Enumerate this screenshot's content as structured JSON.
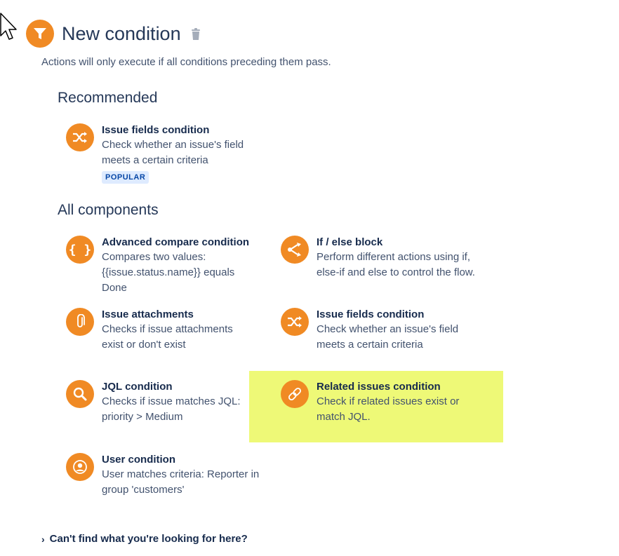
{
  "header": {
    "title": "New condition",
    "subtitle": "Actions will only execute if all conditions preceding them pass."
  },
  "recommended": {
    "heading": "Recommended",
    "items": [
      {
        "icon": "shuffle-icon",
        "title": "Issue fields condition",
        "desc": "Check whether an issue's field meets a certain criteria",
        "badge": "POPULAR"
      }
    ]
  },
  "all": {
    "heading": "All components",
    "items": [
      {
        "icon": "braces-icon",
        "title": "Advanced compare condition",
        "desc": "Compares two values: {{issue.status.name}} equals Done"
      },
      {
        "icon": "branch-icon",
        "title": "If / else block",
        "desc": "Perform different actions using if, else-if and else to control the flow."
      },
      {
        "icon": "paperclip-icon",
        "title": "Issue attachments",
        "desc": "Checks if issue attachments exist or don't exist"
      },
      {
        "icon": "shuffle-icon",
        "title": "Issue fields condition",
        "desc": "Check whether an issue's field meets a certain criteria"
      },
      {
        "icon": "search-icon",
        "title": "JQL condition",
        "desc": "Checks if issue matches JQL: priority > Medium"
      },
      {
        "icon": "link-icon",
        "title": "Related issues condition",
        "desc": "Check if related issues exist or match JQL."
      },
      {
        "icon": "user-icon",
        "title": "User condition",
        "desc": "User matches criteria: Reporter in group 'customers'"
      }
    ]
  },
  "footer": {
    "label": "Can't find what you're looking for here?"
  },
  "colors": {
    "accent": "#f08a24",
    "highlight": "#eef977",
    "badge_bg": "#deebff",
    "badge_text": "#0747a6"
  }
}
